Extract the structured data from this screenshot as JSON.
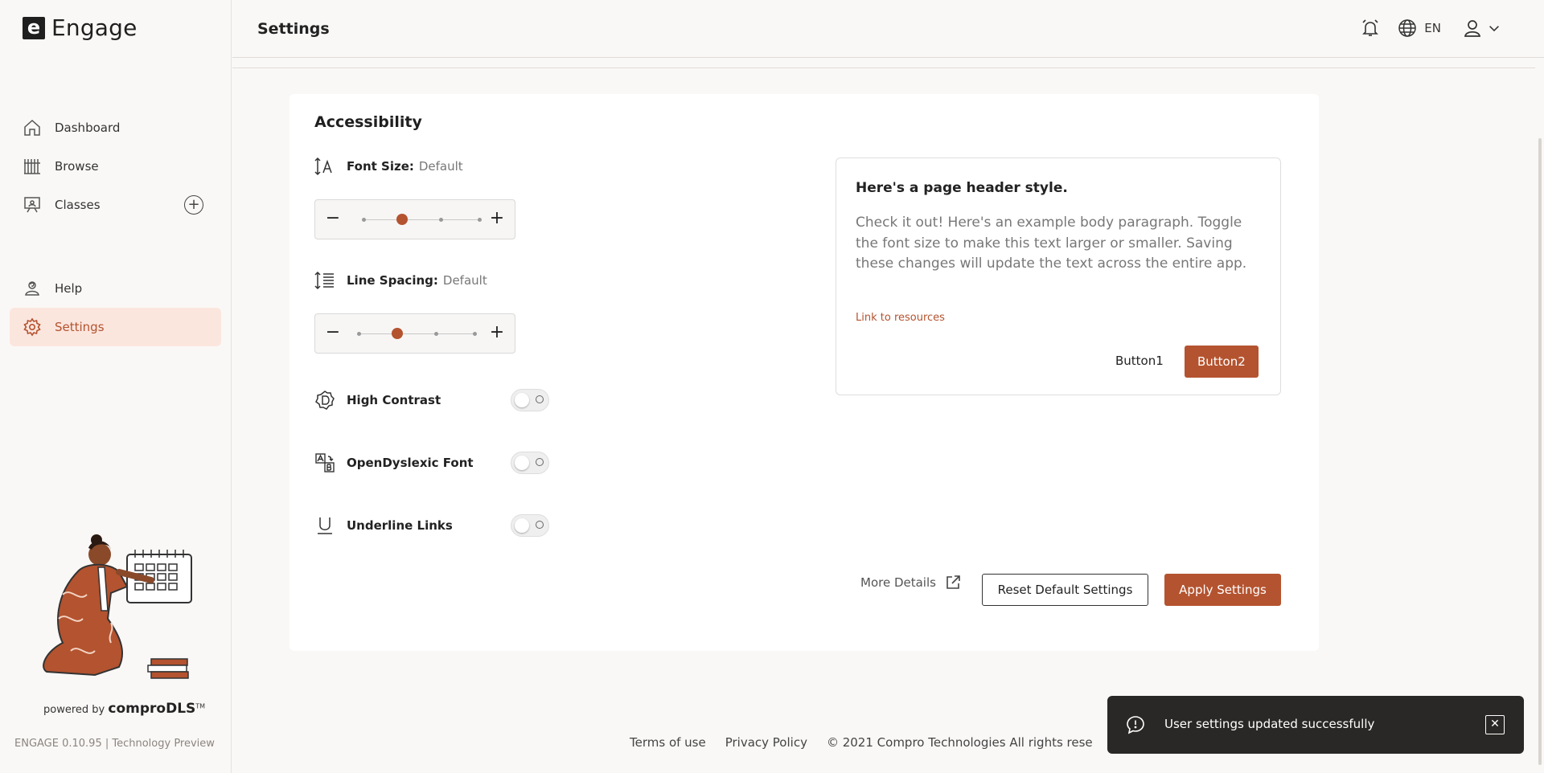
{
  "app": {
    "logo_mark": "e",
    "name": "Engage"
  },
  "sidebar": {
    "items": [
      {
        "label": "Dashboard",
        "icon": "home-icon"
      },
      {
        "label": "Browse",
        "icon": "library-icon"
      },
      {
        "label": "Classes",
        "icon": "classroom-icon",
        "action_icon": "add-circle-icon"
      },
      {
        "label": "Help",
        "icon": "help-icon"
      },
      {
        "label": "Settings",
        "icon": "gear-icon",
        "active": true
      }
    ],
    "powered_prefix": "powered by",
    "powered_brand": "comproDLS",
    "powered_tm": "TM",
    "version": "ENGAGE 0.10.95 | Technology Preview"
  },
  "header": {
    "title": "Settings",
    "language": "EN"
  },
  "accessibility": {
    "title": "Accessibility",
    "font_size": {
      "label": "Font Size:",
      "value": "Default",
      "level_index": 1,
      "levels": 4,
      "minus": "−",
      "plus": "+"
    },
    "line_spacing": {
      "label": "Line Spacing:",
      "value": "Default",
      "level_index": 1,
      "levels": 4,
      "minus": "−",
      "plus": "+"
    },
    "toggles": [
      {
        "label": "High Contrast",
        "on": false,
        "icon": "contrast-icon"
      },
      {
        "label": "OpenDyslexic Font",
        "on": false,
        "icon": "font-translate-icon"
      },
      {
        "label": "Underline Links",
        "on": false,
        "icon": "underline-icon"
      }
    ]
  },
  "preview": {
    "title": "Here's a page header style.",
    "body": "Check it out! Here's an example body paragraph. Toggle the font size to make this text larger or smaller. Saving these changes will update the text across the entire app.",
    "link": "Link to resources",
    "button1": "Button1",
    "button2": "Button2"
  },
  "actions": {
    "more_details": "More Details",
    "reset": "Reset Default Settings",
    "apply": "Apply Settings"
  },
  "footer": {
    "terms": "Terms of use",
    "privacy": "Privacy Policy",
    "copyright": "© 2021 Compro Technologies All rights rese"
  },
  "toast": {
    "message": "User settings updated successfully"
  },
  "colors": {
    "accent": "#b4532f",
    "active_bg": "#fbe6de",
    "toast_bg": "#2a2826"
  }
}
